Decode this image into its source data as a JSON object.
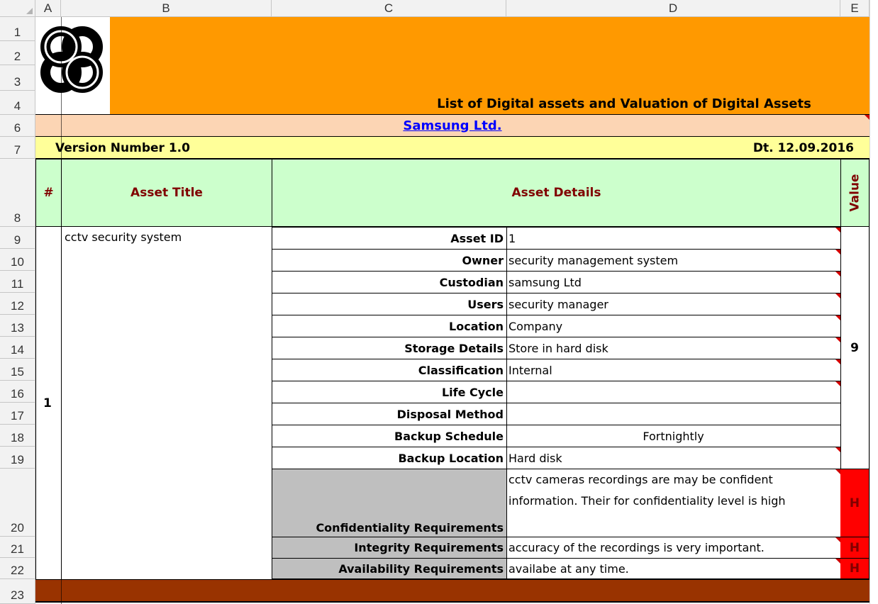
{
  "columns": [
    "A",
    "B",
    "C",
    "D",
    "E"
  ],
  "rows": [
    "1",
    "2",
    "3",
    "4",
    "6",
    "7",
    "8",
    "9",
    "10",
    "11",
    "12",
    "13",
    "14",
    "15",
    "16",
    "17",
    "18",
    "19",
    "20",
    "21",
    "22",
    "23"
  ],
  "sheet": {
    "title": "List of Digital assets and Valuation of Digital Assets",
    "company": "Samsung Ltd.",
    "version": "Version Number 1.0",
    "date": "Dt. 12.09.2016",
    "header": {
      "num": "#",
      "asset_title": "Asset Title",
      "asset_details": "Asset Details",
      "value": "Value"
    },
    "asset_number": "1",
    "asset_title": "cctv security system",
    "details": [
      {
        "label": "Asset ID",
        "value": "1"
      },
      {
        "label": "Owner",
        "value": "security management system"
      },
      {
        "label": "Custodian",
        "value": "samsung Ltd"
      },
      {
        "label": "Users",
        "value": "security manager"
      },
      {
        "label": "Location",
        "value": "Company"
      },
      {
        "label": "Storage Details",
        "value": "Store in hard disk"
      },
      {
        "label": "Classification",
        "value": "Internal"
      },
      {
        "label": "Life Cycle",
        "value": ""
      },
      {
        "label": "Disposal Method",
        "value": ""
      },
      {
        "label": "Backup Schedule",
        "value": "Fortnightly"
      },
      {
        "label": "Backup Location",
        "value": "Hard disk"
      }
    ],
    "asset_value": "9",
    "requirements": [
      {
        "label": "Confidentiality Requirements",
        "line1": "cctv cameras recordings are may be confident",
        "line2": "information. Their for confidentiality level is high",
        "rating": "H"
      },
      {
        "label": "Integrity Requirements",
        "value": "accuracy of the recordings is very important.",
        "rating": "H"
      },
      {
        "label": "Availability Requirements",
        "value": "availabe at any time.",
        "rating": "H"
      }
    ]
  },
  "colors": {
    "title_bar": "#ff9900",
    "company_bar": "#fcd5b4",
    "version_bar": "#ffff99",
    "header_green": "#ccffcc",
    "header_text": "#800000",
    "gray_label": "#bfbfbf",
    "rating_red": "#ff0000",
    "footer_brown": "#993300",
    "link_blue": "#0000ff"
  },
  "icons": {
    "logo": "interlocking-rings-logo",
    "comment": "comment-indicator-triangle"
  }
}
